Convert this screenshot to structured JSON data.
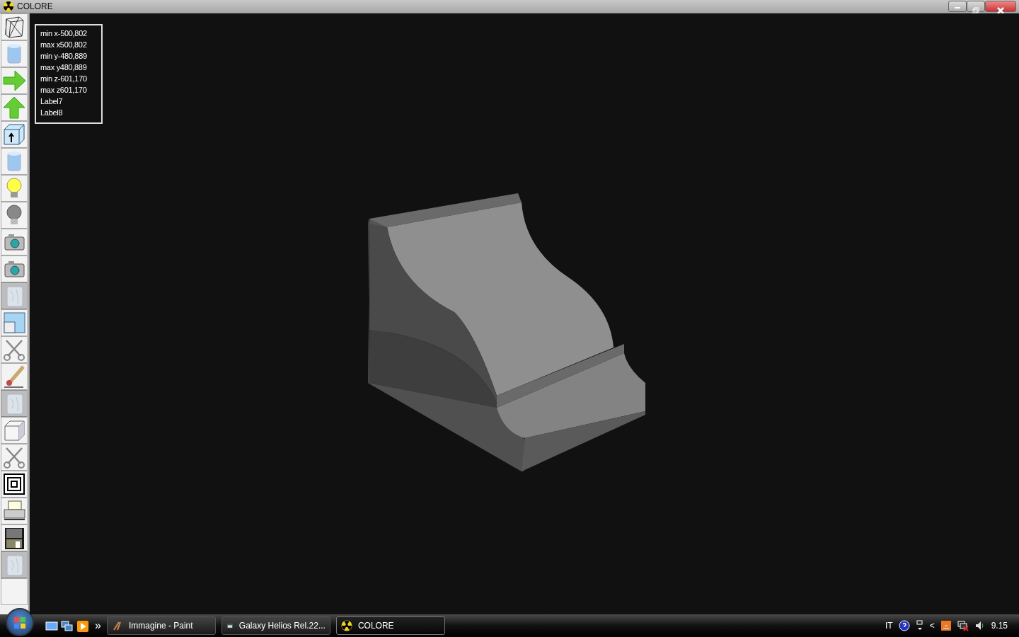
{
  "window": {
    "title": "COLORE"
  },
  "toolbar": [
    {
      "kind": "wireframe",
      "disabled": false
    },
    {
      "kind": "cylinder",
      "disabled": false
    },
    {
      "kind": "arrow-right",
      "disabled": false
    },
    {
      "kind": "arrow-up",
      "disabled": false
    },
    {
      "kind": "box-arrow",
      "disabled": false
    },
    {
      "kind": "cylinder",
      "disabled": false
    },
    {
      "kind": "bulb-on",
      "disabled": false
    },
    {
      "kind": "bulb-off",
      "disabled": false
    },
    {
      "kind": "camera",
      "disabled": false
    },
    {
      "kind": "camera",
      "disabled": false
    },
    {
      "kind": "marble",
      "disabled": true
    },
    {
      "kind": "viewport",
      "disabled": false
    },
    {
      "kind": "scissors",
      "disabled": false
    },
    {
      "kind": "brush",
      "disabled": false
    },
    {
      "kind": "marble",
      "disabled": true
    },
    {
      "kind": "cube",
      "disabled": false
    },
    {
      "kind": "scissors",
      "disabled": false
    },
    {
      "kind": "squares",
      "disabled": false
    },
    {
      "kind": "printer",
      "disabled": false
    },
    {
      "kind": "floppy",
      "disabled": false
    },
    {
      "kind": "marble",
      "disabled": true
    },
    {
      "kind": "blank",
      "disabled": false
    }
  ],
  "info_labels": [
    "min x-500,802",
    "max x500,802",
    "min y-480,889",
    "max y480,889",
    "min z-601,170",
    "max z601,170",
    "Label7",
    "Label8"
  ],
  "taskbar": {
    "overflow": "»",
    "tasks": [
      {
        "label": "Immagine - Paint",
        "kind": "paint",
        "selected": false
      },
      {
        "label": "Galaxy Helios  Rel.22...",
        "kind": "window",
        "selected": false
      },
      {
        "label": "COLORE",
        "kind": "radiation",
        "selected": true
      }
    ],
    "tray": {
      "language": "IT",
      "chevron": "<",
      "clock": "9.15"
    }
  }
}
